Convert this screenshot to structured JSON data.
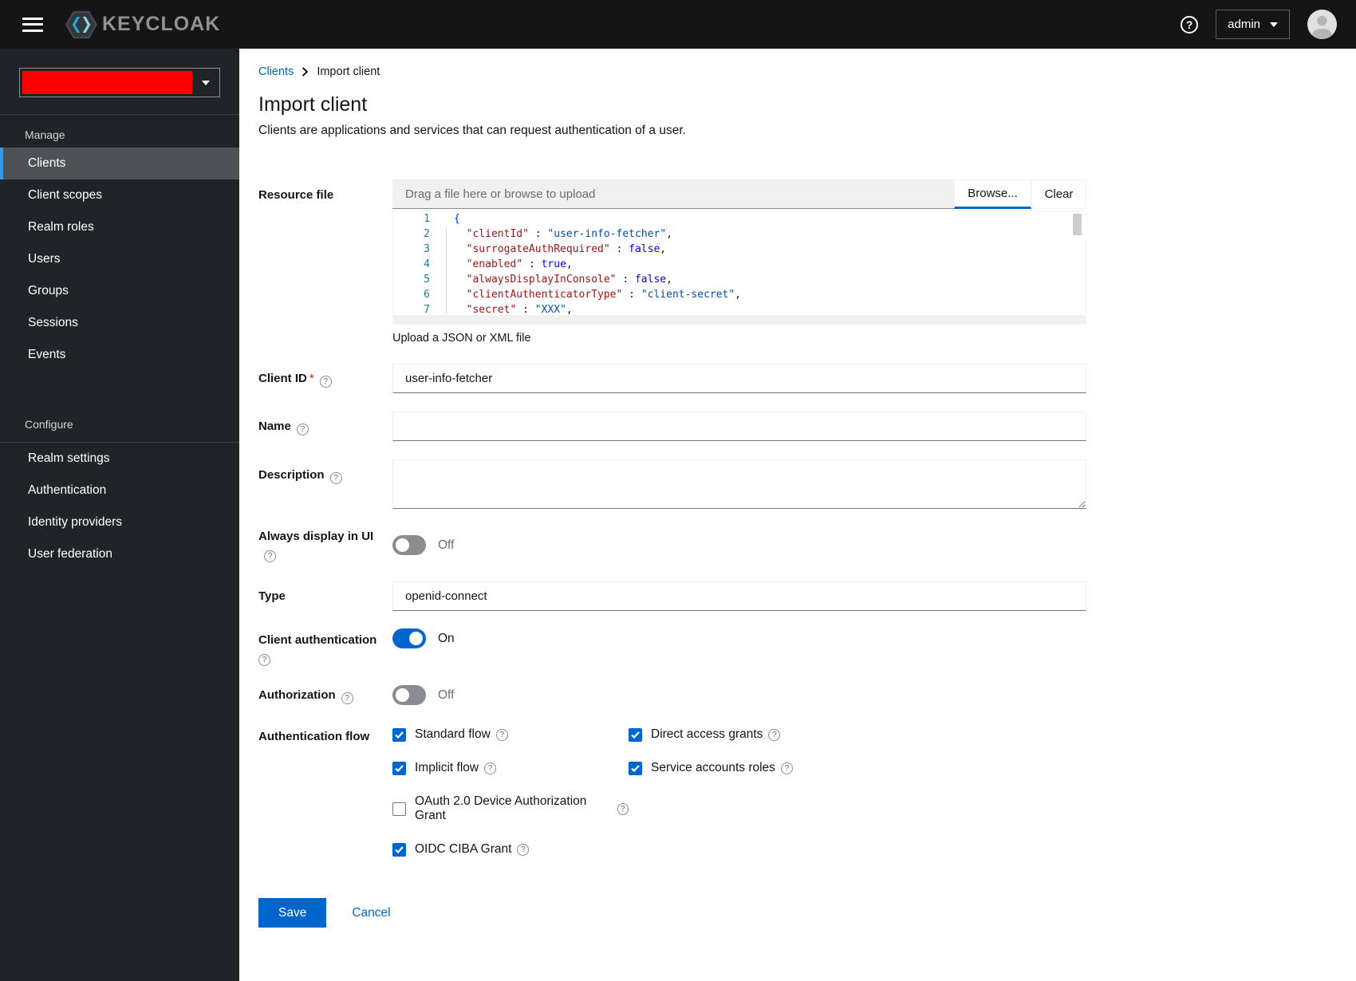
{
  "masthead": {
    "brand": "KEYCLOAK",
    "username": "admin"
  },
  "sidebar": {
    "realm_redaction_color": "#ff0000",
    "sections": [
      {
        "title": "Manage",
        "divider": "above",
        "items": [
          {
            "label": "Clients",
            "active": true
          },
          {
            "label": "Client scopes",
            "active": false
          },
          {
            "label": "Realm roles",
            "active": false
          },
          {
            "label": "Users",
            "active": false
          },
          {
            "label": "Groups",
            "active": false
          },
          {
            "label": "Sessions",
            "active": false
          },
          {
            "label": "Events",
            "active": false
          }
        ]
      },
      {
        "title": "Configure",
        "divider": "below",
        "items": [
          {
            "label": "Realm settings",
            "active": false
          },
          {
            "label": "Authentication",
            "active": false
          },
          {
            "label": "Identity providers",
            "active": false
          },
          {
            "label": "User federation",
            "active": false
          }
        ]
      }
    ]
  },
  "breadcrumb": {
    "parent": "Clients",
    "current": "Import client"
  },
  "page": {
    "title": "Import client",
    "description": "Clients are applications and services that can request authentication of a user."
  },
  "form": {
    "resource_file": {
      "label": "Resource file",
      "placeholder": "Drag a file here or browse to upload",
      "browse_label": "Browse...",
      "clear_label": "Clear",
      "helper": "Upload a JSON or XML file",
      "code_lines": [
        {
          "num": "1",
          "tokens": [
            {
              "c": "br",
              "t": "{"
            }
          ]
        },
        {
          "num": "2",
          "tokens": [
            {
              "c": "p",
              "t": "  "
            },
            {
              "c": "k",
              "t": "\"clientId\""
            },
            {
              "c": "p",
              "t": " : "
            },
            {
              "c": "s",
              "t": "\"user-info-fetcher\""
            },
            {
              "c": "p",
              "t": ","
            }
          ]
        },
        {
          "num": "3",
          "tokens": [
            {
              "c": "p",
              "t": "  "
            },
            {
              "c": "k",
              "t": "\"surrogateAuthRequired\""
            },
            {
              "c": "p",
              "t": " : "
            },
            {
              "c": "b",
              "t": "false"
            },
            {
              "c": "p",
              "t": ","
            }
          ]
        },
        {
          "num": "4",
          "tokens": [
            {
              "c": "p",
              "t": "  "
            },
            {
              "c": "k",
              "t": "\"enabled\""
            },
            {
              "c": "p",
              "t": " : "
            },
            {
              "c": "b",
              "t": "true"
            },
            {
              "c": "p",
              "t": ","
            }
          ]
        },
        {
          "num": "5",
          "tokens": [
            {
              "c": "p",
              "t": "  "
            },
            {
              "c": "k",
              "t": "\"alwaysDisplayInConsole\""
            },
            {
              "c": "p",
              "t": " : "
            },
            {
              "c": "b",
              "t": "false"
            },
            {
              "c": "p",
              "t": ","
            }
          ]
        },
        {
          "num": "6",
          "tokens": [
            {
              "c": "p",
              "t": "  "
            },
            {
              "c": "k",
              "t": "\"clientAuthenticatorType\""
            },
            {
              "c": "p",
              "t": " : "
            },
            {
              "c": "s",
              "t": "\"client-secret\""
            },
            {
              "c": "p",
              "t": ","
            }
          ]
        },
        {
          "num": "7",
          "tokens": [
            {
              "c": "p",
              "t": "  "
            },
            {
              "c": "k",
              "t": "\"secret\""
            },
            {
              "c": "p",
              "t": " : "
            },
            {
              "c": "s",
              "t": "\"XXX\""
            },
            {
              "c": "p",
              "t": ","
            }
          ]
        }
      ]
    },
    "client_id": {
      "label": "Client ID",
      "required": true,
      "value": "user-info-fetcher"
    },
    "name": {
      "label": "Name",
      "value": ""
    },
    "description": {
      "label": "Description",
      "value": ""
    },
    "always_display": {
      "label": "Always display in UI",
      "state": "Off"
    },
    "type": {
      "label": "Type",
      "value": "openid-connect"
    },
    "client_auth": {
      "label": "Client authentication",
      "state": "On"
    },
    "authorization": {
      "label": "Authorization",
      "state": "Off"
    },
    "auth_flow": {
      "label": "Authentication flow",
      "items": [
        {
          "label": "Standard flow",
          "checked": true,
          "col": 1
        },
        {
          "label": "Direct access grants",
          "checked": true,
          "col": 2
        },
        {
          "label": "Implicit flow",
          "checked": true,
          "col": 1
        },
        {
          "label": "Service accounts roles",
          "checked": true,
          "col": 2
        },
        {
          "label": "OAuth 2.0 Device Authorization Grant",
          "checked": false,
          "col": 1
        },
        {
          "label": "OIDC CIBA Grant",
          "checked": true,
          "col": 1
        }
      ]
    },
    "actions": {
      "save": "Save",
      "cancel": "Cancel"
    }
  },
  "icons": {
    "hamburger-icon": "three-bars",
    "keycloak-logo": "hexagon-with-chevrons",
    "help-icon": "question-circle",
    "user-avatar-icon": "person-silhouette",
    "dropdown-caret-icon": "triangle-down",
    "breadcrumb-chevron-icon": "angle-right",
    "field-help-icon": "question-circle-outline"
  },
  "colors": {
    "masthead_bg": "#151515",
    "sidebar_bg": "#212427",
    "nav_active_bg": "#4f5255",
    "nav_active_border": "#2b9af3",
    "primary_blue": "#0066cc",
    "code_key": "#a31515",
    "code_string": "#0451a5",
    "code_bool": "#0000ff",
    "line_number": "#237893",
    "required_red": "#c9190b"
  }
}
